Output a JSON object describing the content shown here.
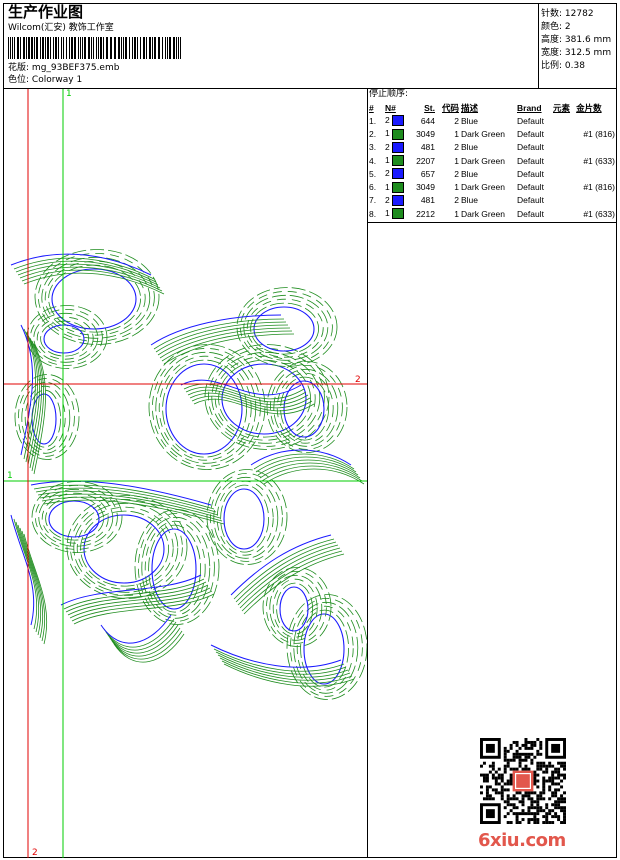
{
  "header": {
    "title": "生产作业图",
    "company": "Wilcom(汇安) 教饰工作室",
    "design_label": "花版:",
    "design_value": "mg_93BEF375.emb",
    "colorway_label": "色位:",
    "colorway_value": "Colorway 1"
  },
  "info": {
    "stitches_label": "针数:",
    "stitches_value": "12782",
    "colors_label": "颜色:",
    "colors_value": "2",
    "height_label": "高度:",
    "height_value": "381.6 mm",
    "width_label": "宽度:",
    "width_value": "312.5 mm",
    "scale_label": "比例:",
    "scale_value": "0.38"
  },
  "stop_sequence": {
    "title": "停止顺序:",
    "headers": [
      "#",
      "N#",
      "St.",
      "代码",
      "描述",
      "Brand",
      "元素",
      "金片数"
    ],
    "rows": [
      {
        "no": "1.",
        "n": "2",
        "color": "#1a1aff",
        "st": "644",
        "code": "2",
        "desc": "Blue",
        "brand": "Default",
        "elem": ""
      },
      {
        "no": "2.",
        "n": "1",
        "color": "#1e8c1e",
        "st": "3049",
        "code": "1",
        "desc": "Dark Green",
        "brand": "Default",
        "elem": "#1 (816)"
      },
      {
        "no": "3.",
        "n": "2",
        "color": "#1a1aff",
        "st": "481",
        "code": "2",
        "desc": "Blue",
        "brand": "Default",
        "elem": ""
      },
      {
        "no": "4.",
        "n": "1",
        "color": "#1e8c1e",
        "st": "2207",
        "code": "1",
        "desc": "Dark Green",
        "brand": "Default",
        "elem": "#1 (633)"
      },
      {
        "no": "5.",
        "n": "2",
        "color": "#1a1aff",
        "st": "657",
        "code": "2",
        "desc": "Blue",
        "brand": "Default",
        "elem": ""
      },
      {
        "no": "6.",
        "n": "1",
        "color": "#1e8c1e",
        "st": "3049",
        "code": "1",
        "desc": "Dark Green",
        "brand": "Default",
        "elem": "#1 (816)"
      },
      {
        "no": "7.",
        "n": "2",
        "color": "#1a1aff",
        "st": "481",
        "code": "2",
        "desc": "Blue",
        "brand": "Default",
        "elem": ""
      },
      {
        "no": "8.",
        "n": "1",
        "color": "#1e8c1e",
        "st": "2212",
        "code": "1",
        "desc": "Dark Green",
        "brand": "Default",
        "elem": "#1 (633)"
      }
    ]
  },
  "guides": {
    "green_v_label": "1",
    "green_h_label": "1",
    "red_h_label": "2",
    "red_v_label": "2",
    "green_color": "#00cc00",
    "red_color": "#e00000"
  },
  "colors": {
    "blue_thread": "#1a1aff",
    "green_thread": "#1e8c1e",
    "watermark": "#e2574c"
  },
  "watermark": "6xiu.com"
}
